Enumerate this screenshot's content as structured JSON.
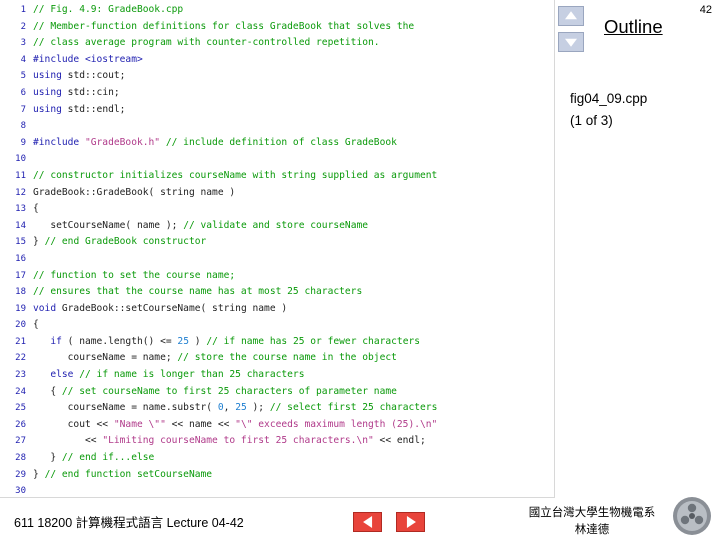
{
  "slide": {
    "page_number": "42",
    "outline_label": "Outline",
    "figure_caption_line1": "fig04_09.cpp",
    "figure_caption_line2": "(1 of 3)",
    "footer_left": "611 18200 計算機程式語言  Lecture 04-42",
    "footer_center_line1": "國立台灣大學生物機電系",
    "footer_center_line2": "林達德",
    "nav": {
      "up_arrow": "scroll-up",
      "down_arrow": "scroll-down",
      "prev": "previous-slide",
      "next": "next-slide"
    }
  },
  "code": {
    "language": "cpp",
    "lines": [
      {
        "n": "1",
        "segments": [
          {
            "cls": "cm",
            "t": "// Fig. 4.9: GradeBook.cpp"
          }
        ]
      },
      {
        "n": "2",
        "segments": [
          {
            "cls": "cm",
            "t": "// Member-function definitions for class GradeBook that solves the"
          }
        ]
      },
      {
        "n": "3",
        "segments": [
          {
            "cls": "cm",
            "t": "// class average program with counter-controlled repetition."
          }
        ]
      },
      {
        "n": "4",
        "segments": [
          {
            "cls": "pp",
            "t": "#include <iostream>"
          }
        ]
      },
      {
        "n": "5",
        "segments": [
          {
            "cls": "kw",
            "t": "using"
          },
          {
            "cls": "pl",
            "t": " std::cout;"
          }
        ]
      },
      {
        "n": "6",
        "segments": [
          {
            "cls": "kw",
            "t": "using"
          },
          {
            "cls": "pl",
            "t": " std::cin;"
          }
        ]
      },
      {
        "n": "7",
        "segments": [
          {
            "cls": "kw",
            "t": "using"
          },
          {
            "cls": "pl",
            "t": " std::endl;"
          }
        ]
      },
      {
        "n": "8",
        "segments": []
      },
      {
        "n": "9",
        "segments": [
          {
            "cls": "pp",
            "t": "#include "
          },
          {
            "cls": "st",
            "t": "\"GradeBook.h\""
          },
          {
            "cls": "cm",
            "t": " // include definition of class GradeBook"
          }
        ]
      },
      {
        "n": "10",
        "segments": []
      },
      {
        "n": "11",
        "segments": [
          {
            "cls": "cm",
            "t": "// constructor initializes courseName with string supplied as argument"
          }
        ]
      },
      {
        "n": "12",
        "segments": [
          {
            "cls": "pl",
            "t": "GradeBook::GradeBook( string name )"
          }
        ]
      },
      {
        "n": "13",
        "segments": [
          {
            "cls": "pl",
            "t": "{"
          }
        ]
      },
      {
        "n": "14",
        "segments": [
          {
            "cls": "pl",
            "t": "   setCourseName( name ); "
          },
          {
            "cls": "cm",
            "t": "// validate and store courseName"
          }
        ]
      },
      {
        "n": "15",
        "segments": [
          {
            "cls": "pl",
            "t": "} "
          },
          {
            "cls": "cm",
            "t": "// end GradeBook constructor"
          }
        ]
      },
      {
        "n": "16",
        "segments": []
      },
      {
        "n": "17",
        "segments": [
          {
            "cls": "cm",
            "t": "// function to set the course name;"
          }
        ]
      },
      {
        "n": "18",
        "segments": [
          {
            "cls": "cm",
            "t": "// ensures that the course name has at most 25 characters"
          }
        ]
      },
      {
        "n": "19",
        "segments": [
          {
            "cls": "kw",
            "t": "void"
          },
          {
            "cls": "pl",
            "t": " GradeBook::setCourseName( string name )"
          }
        ]
      },
      {
        "n": "20",
        "segments": [
          {
            "cls": "pl",
            "t": "{"
          }
        ]
      },
      {
        "n": "21",
        "segments": [
          {
            "cls": "pl",
            "t": "   "
          },
          {
            "cls": "kw",
            "t": "if"
          },
          {
            "cls": "pl",
            "t": " ( name.length() <= "
          },
          {
            "cls": "nu",
            "t": "25"
          },
          {
            "cls": "pl",
            "t": " ) "
          },
          {
            "cls": "cm",
            "t": "// if name has 25 or fewer characters"
          }
        ]
      },
      {
        "n": "22",
        "segments": [
          {
            "cls": "pl",
            "t": "      courseName = name; "
          },
          {
            "cls": "cm",
            "t": "// store the course name in the object"
          }
        ]
      },
      {
        "n": "23",
        "segments": [
          {
            "cls": "pl",
            "t": "   "
          },
          {
            "cls": "kw",
            "t": "else"
          },
          {
            "cls": "cm",
            "t": " // if name is longer than 25 characters"
          }
        ]
      },
      {
        "n": "24",
        "segments": [
          {
            "cls": "pl",
            "t": "   { "
          },
          {
            "cls": "cm",
            "t": "// set courseName to first 25 characters of parameter name"
          }
        ]
      },
      {
        "n": "25",
        "segments": [
          {
            "cls": "pl",
            "t": "      courseName = name.substr( "
          },
          {
            "cls": "nu",
            "t": "0"
          },
          {
            "cls": "pl",
            "t": ", "
          },
          {
            "cls": "nu",
            "t": "25"
          },
          {
            "cls": "pl",
            "t": " ); "
          },
          {
            "cls": "cm",
            "t": "// select first 25 characters"
          }
        ]
      },
      {
        "n": "26",
        "segments": [
          {
            "cls": "pl",
            "t": "      cout << "
          },
          {
            "cls": "st",
            "t": "\"Name \\\"\""
          },
          {
            "cls": "pl",
            "t": " << name << "
          },
          {
            "cls": "st",
            "t": "\"\\\" exceeds maximum length (25).\\n\""
          }
        ]
      },
      {
        "n": "27",
        "segments": [
          {
            "cls": "pl",
            "t": "         << "
          },
          {
            "cls": "st",
            "t": "\"Limiting courseName to first 25 characters.\\n\""
          },
          {
            "cls": "pl",
            "t": " << endl;"
          }
        ]
      },
      {
        "n": "28",
        "segments": [
          {
            "cls": "pl",
            "t": "   } "
          },
          {
            "cls": "cm",
            "t": "// end if...else"
          }
        ]
      },
      {
        "n": "29",
        "segments": [
          {
            "cls": "pl",
            "t": "} "
          },
          {
            "cls": "cm",
            "t": "// end function setCourseName"
          }
        ]
      },
      {
        "n": "30",
        "segments": []
      }
    ]
  }
}
